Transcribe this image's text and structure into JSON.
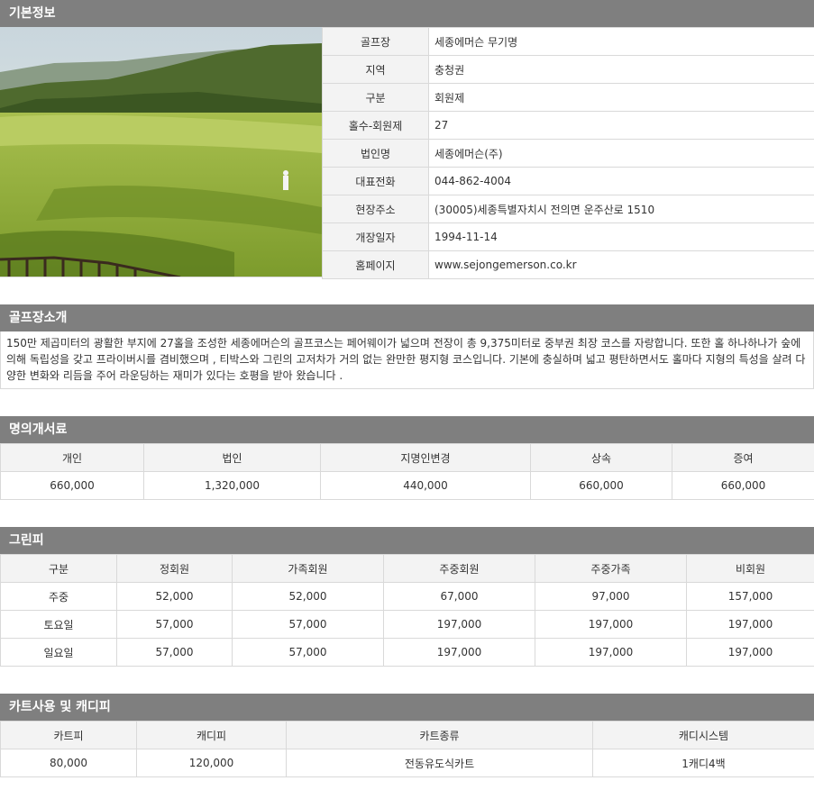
{
  "basic": {
    "header": "기본정보",
    "rows": [
      {
        "label": "골프장",
        "value": "세종에머슨 무기명"
      },
      {
        "label": "지역",
        "value": "충청권"
      },
      {
        "label": "구분",
        "value": "회원제"
      },
      {
        "label": "홀수-회원제",
        "value": "27"
      },
      {
        "label": "법인명",
        "value": "세종에머슨(주)"
      },
      {
        "label": "대표전화",
        "value": "044-862-4004"
      },
      {
        "label": "현장주소",
        "value": "(30005)세종특별자치시 전의면 운주산로 1510"
      },
      {
        "label": "개장일자",
        "value": "1994-11-14"
      },
      {
        "label": "홈페이지",
        "value": "www.sejongemerson.co.kr"
      }
    ]
  },
  "intro": {
    "header": "골프장소개",
    "text": "150만 제곱미터의 광활한 부지에 27홀을 조성한 세종에머슨의 골프코스는 페어웨이가 넓으며 전장이 총 9,375미터로 중부권 최장 코스를 자랑합니다. 또한 홀 하나하나가 숲에 의해 독립성을 갖고 프라이버시를 겸비했으며 , 티박스와 그린의 고저차가 거의 없는 완만한 평지형 코스입니다. 기본에 충실하며 넓고 평탄하면서도 홀마다 지형의 특성을 살려 다양한 변화와 리듬을 주어 라운딩하는 재미가 있다는 호평을 받아 왔습니다 ."
  },
  "transfer": {
    "header": "명의개서료",
    "columns": [
      "개인",
      "법인",
      "지명인변경",
      "상속",
      "증여"
    ],
    "values": [
      "660,000",
      "1,320,000",
      "440,000",
      "660,000",
      "660,000"
    ]
  },
  "greenfee": {
    "header": "그린피",
    "columns": [
      "구분",
      "정회원",
      "가족회원",
      "주중회원",
      "주중가족",
      "비회원"
    ],
    "rows": [
      [
        "주중",
        "52,000",
        "52,000",
        "67,000",
        "97,000",
        "157,000"
      ],
      [
        "토요일",
        "57,000",
        "57,000",
        "197,000",
        "197,000",
        "197,000"
      ],
      [
        "일요일",
        "57,000",
        "57,000",
        "197,000",
        "197,000",
        "197,000"
      ]
    ]
  },
  "cart": {
    "header": "카트사용 및 캐디피",
    "columns": [
      "카트피",
      "캐디피",
      "카트종류",
      "캐디시스템"
    ],
    "values": [
      "80,000",
      "120,000",
      "전동유도식카트",
      "1캐디4백"
    ]
  }
}
